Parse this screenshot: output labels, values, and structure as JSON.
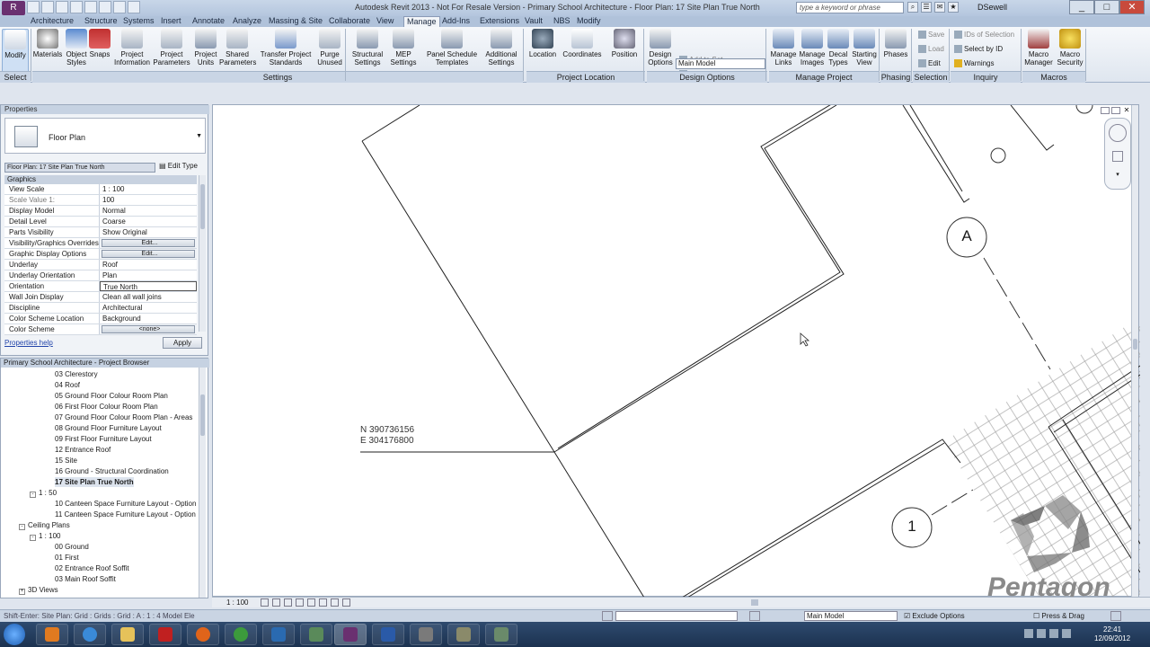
{
  "window": {
    "title": "Autodesk Revit 2013 - Not For Resale Version - Primary School Architecture - Floor Plan: 17 Site Plan True North",
    "search_placeholder": "type a keyword or phrase",
    "user": "DSewell"
  },
  "tabs": [
    "Architecture",
    "Structure",
    "Systems",
    "Insert",
    "Annotate",
    "Analyze",
    "Massing & Site",
    "Collaborate",
    "View",
    "Manage",
    "Add-Ins",
    "Extensions",
    "Vault",
    "NBS",
    "Modify"
  ],
  "active_tab": "Manage",
  "ribbon": {
    "modify": "Modify",
    "settings": [
      "Materials",
      "Object Styles",
      "Snaps",
      "Project Information",
      "Project Parameters",
      "Project Units",
      "Shared Parameters",
      "Transfer Project Standards",
      "Purge Unused"
    ],
    "settings2": [
      "Structural Settings",
      "MEP Settings",
      "Panel Schedule Templates",
      "Additional Settings"
    ],
    "location": [
      "Location",
      "Coordinates",
      "Position"
    ],
    "design_options": {
      "button": "Design Options",
      "add_to_set": "Add to Set",
      "pick_to_edit": "Pick to Edit",
      "current": "Main Model"
    },
    "manage_project": [
      "Manage Links",
      "Manage Images",
      "Decal Types",
      "Starting View"
    ],
    "phases": "Phases",
    "selection": [
      "Save",
      "Load",
      "Edit"
    ],
    "inquiry": [
      "IDs of Selection",
      "Select by ID",
      "Warnings"
    ],
    "macros": [
      "Macro Manager",
      "Macro Security"
    ],
    "panel_labels": [
      "Select",
      "Settings",
      "Project Location",
      "Design Options",
      "Manage Project",
      "Phasing",
      "Selection",
      "Inquiry",
      "Macros"
    ]
  },
  "properties": {
    "title": "Properties",
    "type": "Floor Plan",
    "instance": "Floor Plan: 17 Site Plan True North",
    "edit_type": "Edit Type",
    "group": "Graphics",
    "rows": [
      {
        "k": "View Scale",
        "v": "1 : 100"
      },
      {
        "k": "Scale Value    1:",
        "v": "100"
      },
      {
        "k": "Display Model",
        "v": "Normal"
      },
      {
        "k": "Detail Level",
        "v": "Coarse"
      },
      {
        "k": "Parts Visibility",
        "v": "Show Original"
      },
      {
        "k": "Visibility/Graphics Overrides",
        "v": "Edit..."
      },
      {
        "k": "Graphic Display Options",
        "v": "Edit..."
      },
      {
        "k": "Underlay",
        "v": "Roof"
      },
      {
        "k": "Underlay Orientation",
        "v": "Plan"
      },
      {
        "k": "Orientation",
        "v": "True North"
      },
      {
        "k": "Wall Join Display",
        "v": "Clean all wall joins"
      },
      {
        "k": "Discipline",
        "v": "Architectural"
      },
      {
        "k": "Color Scheme Location",
        "v": "Background"
      },
      {
        "k": "Color Scheme",
        "v": "<none>"
      }
    ],
    "help": "Properties help",
    "apply": "Apply"
  },
  "browser": {
    "title": "Primary School Architecture - Project Browser",
    "items": [
      {
        "t": "03 Clerestory",
        "lvl": 3
      },
      {
        "t": "04 Roof",
        "lvl": 3
      },
      {
        "t": "05 Ground Floor Colour Room Plan",
        "lvl": 3
      },
      {
        "t": "06 First Floor Colour Room Plan",
        "lvl": 3
      },
      {
        "t": "07 Ground Floor Colour Room Plan - Areas",
        "lvl": 3
      },
      {
        "t": "08 Ground Floor Furniture Layout",
        "lvl": 3
      },
      {
        "t": "09 First Floor Furniture Layout",
        "lvl": 3
      },
      {
        "t": "12 Entrance Roof",
        "lvl": 3
      },
      {
        "t": "15 Site",
        "lvl": 3
      },
      {
        "t": "16 Ground - Structural Coordination",
        "lvl": 3
      },
      {
        "t": "17 Site Plan True North",
        "lvl": 3,
        "sel": true
      },
      {
        "t": "1 : 50",
        "lvl": 2,
        "tw": "-"
      },
      {
        "t": "10 Canteen Space Furniture Layout - Option",
        "lvl": 3
      },
      {
        "t": "11 Canteen Space Furniture Layout - Option",
        "lvl": 3
      },
      {
        "t": "Ceiling Plans",
        "lvl": 1,
        "tw": "-"
      },
      {
        "t": "1 : 100",
        "lvl": 2,
        "tw": "-"
      },
      {
        "t": "00 Ground",
        "lvl": 3
      },
      {
        "t": "01 First",
        "lvl": 3
      },
      {
        "t": "02 Entrance Roof Soffit",
        "lvl": 3
      },
      {
        "t": "03 Main Roof Soffit",
        "lvl": 3
      },
      {
        "t": "3D Views",
        "lvl": 1,
        "tw": "+"
      }
    ]
  },
  "canvas": {
    "coord_n": "N 390736156",
    "coord_e": "E 304176800",
    "grid_a": "A",
    "grid_1": "1",
    "watermark": "Pentagon"
  },
  "view_bar": {
    "scale": "1 : 100"
  },
  "status": {
    "message": "Shift-Enter: Site Plan: Grid : Grids : Grid : A : 1 : 4 Model Ele",
    "model": "Main Model",
    "exclude": "Exclude Options",
    "press_drag": "Press & Drag"
  },
  "clock": {
    "time": "22:41",
    "date": "12/09/2012"
  },
  "colors": {
    "accent": "#3a6fb6",
    "revit_purple": "#6a3070"
  }
}
